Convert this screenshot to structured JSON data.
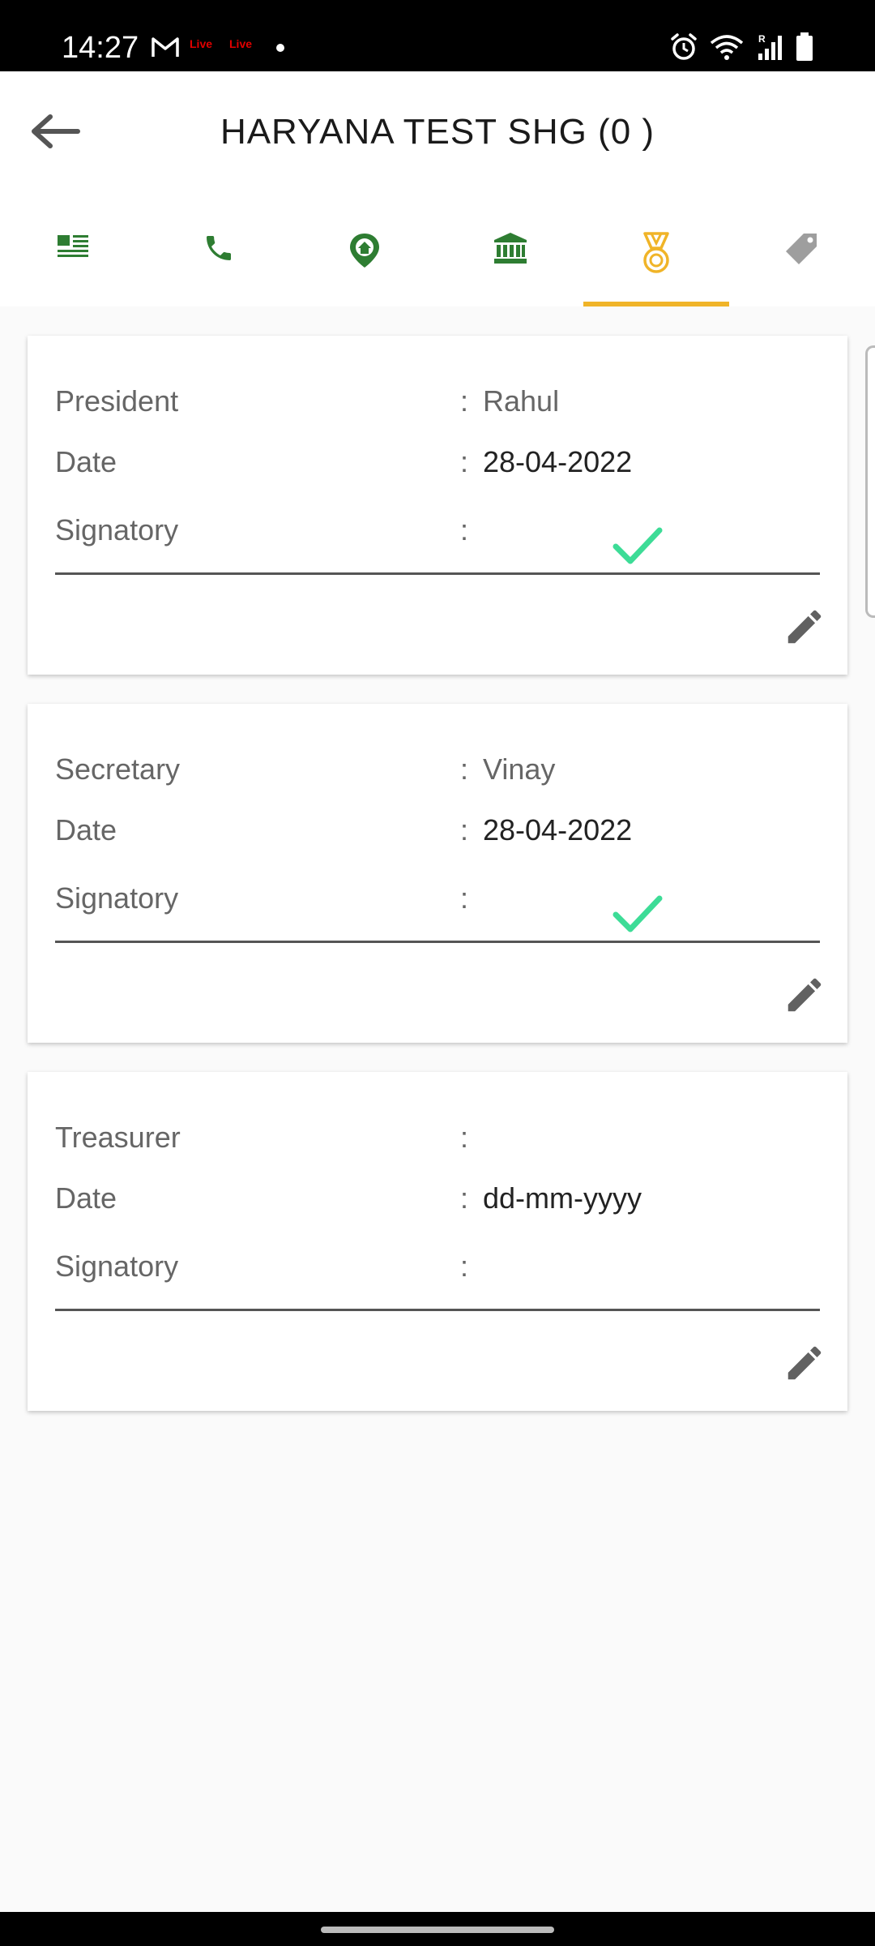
{
  "status_bar": {
    "time": "14:27",
    "live1": "Live",
    "live2": "Live",
    "carrier_indicator": "R"
  },
  "header": {
    "title": "HARYANA TEST SHG (0 )"
  },
  "tabs": [
    {
      "icon": "list-details-icon",
      "color": "#2e7d32",
      "active": false
    },
    {
      "icon": "phone-icon",
      "color": "#2e7d32",
      "active": false
    },
    {
      "icon": "location-home-icon",
      "color": "#2e7d32",
      "active": false
    },
    {
      "icon": "bank-icon",
      "color": "#2e7d32",
      "active": false
    },
    {
      "icon": "medal-icon",
      "color": "#f0b428",
      "active": true
    },
    {
      "icon": "tag-icon",
      "color": "#9e9e9e",
      "active": false
    }
  ],
  "colors": {
    "accent": "#f0b428",
    "tab_green": "#2e7d32",
    "check_green": "#3ddc97"
  },
  "cards": [
    {
      "role_label": "President",
      "role_value": "Rahul",
      "date_label": "Date",
      "date_value": "28-04-2022",
      "signatory_label": "Signatory",
      "signatory_checked": true
    },
    {
      "role_label": "Secretary",
      "role_value": "Vinay",
      "date_label": "Date",
      "date_value": "28-04-2022",
      "signatory_label": "Signatory",
      "signatory_checked": true
    },
    {
      "role_label": "Treasurer",
      "role_value": "",
      "date_label": "Date",
      "date_value": "dd-mm-yyyy",
      "signatory_label": "Signatory",
      "signatory_checked": false
    }
  ],
  "separator": ":"
}
